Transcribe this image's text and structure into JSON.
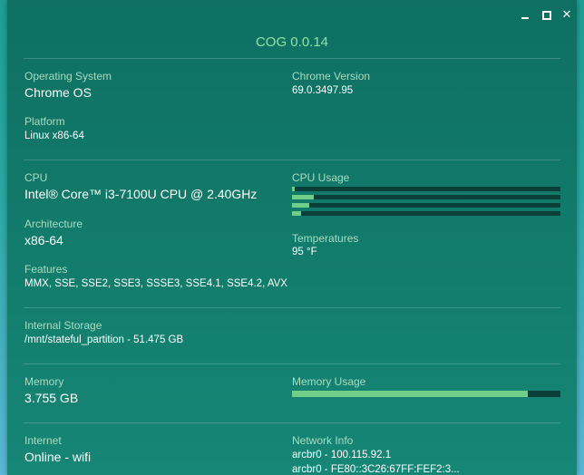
{
  "window": {
    "title": "COG 0.0.14",
    "controls": {
      "minimize_icon": "minimize-icon",
      "maximize_icon": "maximize-icon",
      "close_icon": "close-icon",
      "close_glyph": "✕"
    }
  },
  "system": {
    "os_label": "Operating System",
    "os_value": "Chrome OS",
    "chrome_label": "Chrome Version",
    "chrome_value": "69.0.3497.95",
    "platform_label": "Platform",
    "platform_value": "Linux x86-64"
  },
  "cpu": {
    "label": "CPU",
    "value": "Intel® Core™ i3-7100U CPU @ 2.40GHz",
    "usage_label": "CPU Usage",
    "core_usage": [
      0.01,
      0.08,
      0.065,
      0.035
    ],
    "arch_label": "Architecture",
    "arch_value": "x86-64",
    "temp_label": "Temperatures",
    "temp_value": "95 °F",
    "features_label": "Features",
    "features_value": "MMX, SSE, SSE2, SSE3, SSSE3, SSE4.1, SSE4.2, AVX"
  },
  "storage": {
    "label": "Internal Storage",
    "value": "/mnt/stateful_partition - 51.475 GB"
  },
  "memory": {
    "label": "Memory",
    "value": "3.755 GB",
    "usage_label": "Memory Usage",
    "usage": 0.88
  },
  "network": {
    "internet_label": "Internet",
    "internet_value": "Online - wifi",
    "info_label": "Network Info",
    "info_lines": [
      "arcbr0 - 100.115.92.1",
      "arcbr0 - FE80::3C26:67FF:FEF2:3..."
    ]
  },
  "colors": {
    "accent": "#6fcf86",
    "track": "#0b3f3a",
    "title": "#8fe3a1"
  }
}
